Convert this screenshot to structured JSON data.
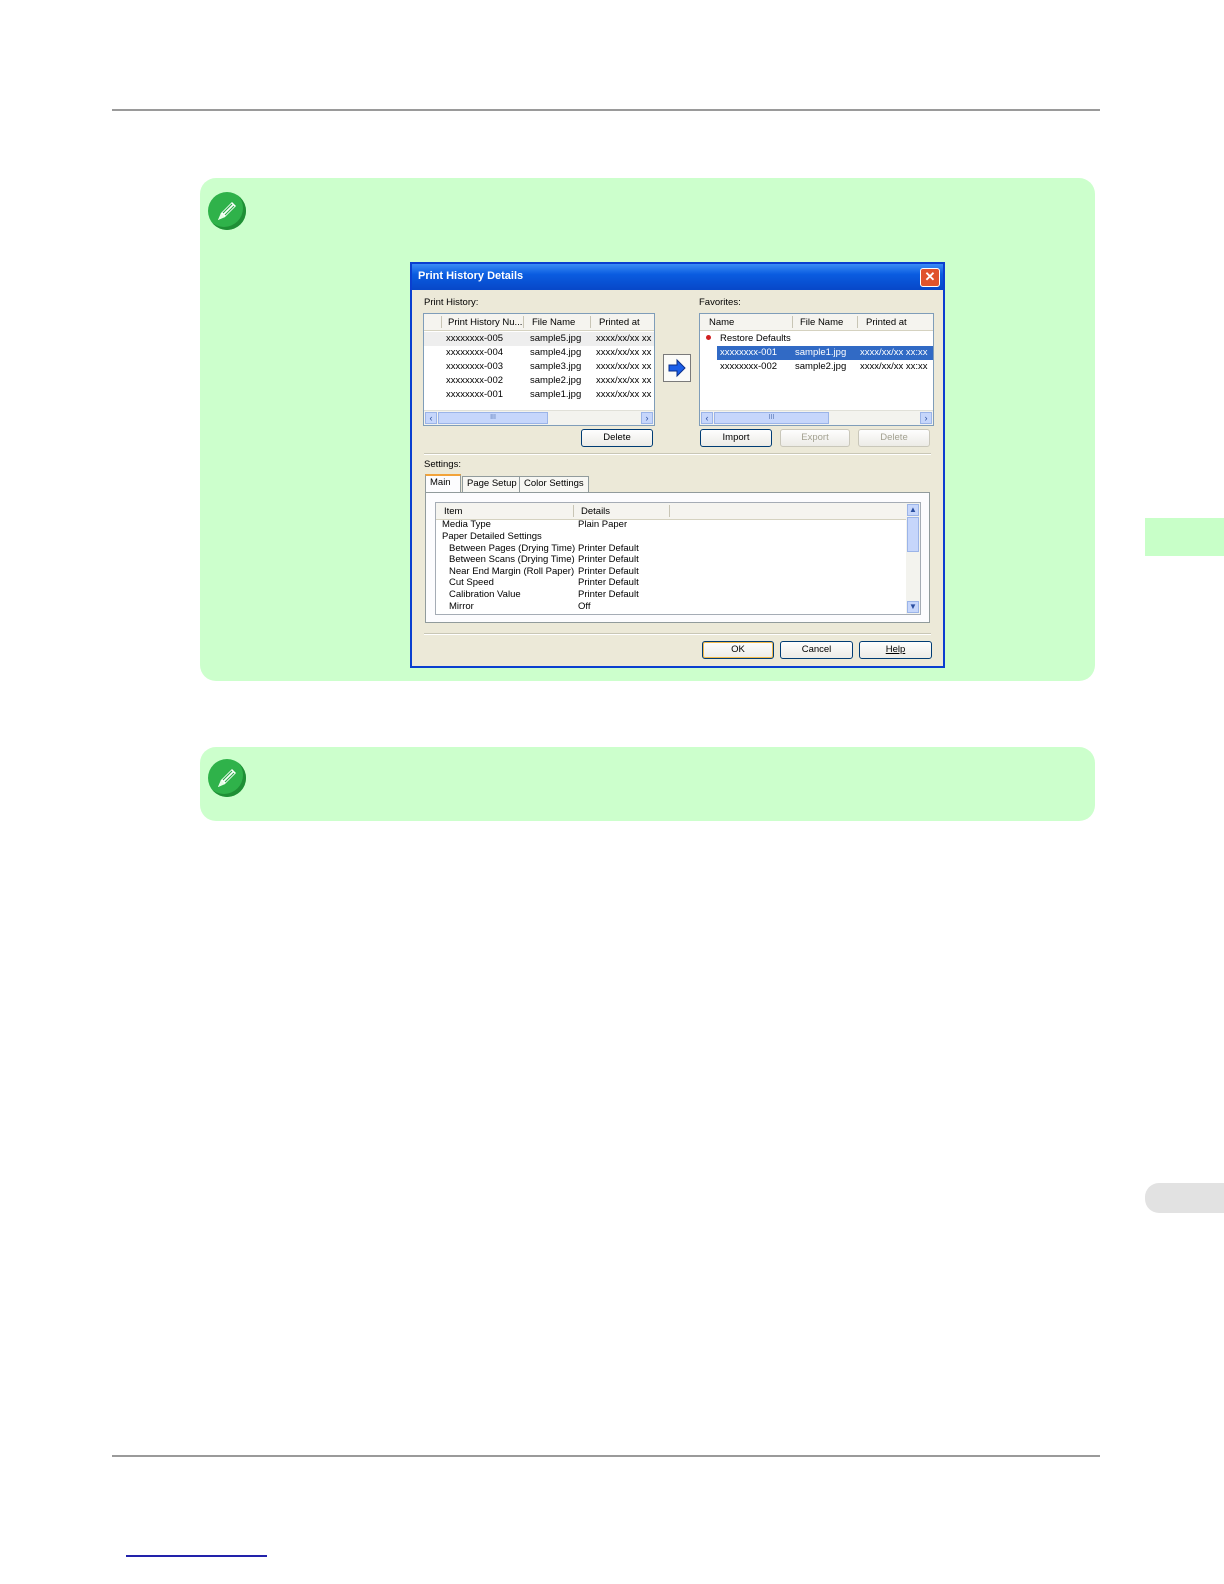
{
  "dialog": {
    "title": "Print History Details",
    "print_history_label": "Print History:",
    "print_history_columns": [
      "Print History Nu...",
      "File Name",
      "Printed at"
    ],
    "print_history_rows": [
      {
        "num": "xxxxxxxx-005",
        "file": "sample5.jpg",
        "printed": "xxxx/xx/xx xx"
      },
      {
        "num": "xxxxxxxx-004",
        "file": "sample4.jpg",
        "printed": "xxxx/xx/xx xx"
      },
      {
        "num": "xxxxxxxx-003",
        "file": "sample3.jpg",
        "printed": "xxxx/xx/xx xx"
      },
      {
        "num": "xxxxxxxx-002",
        "file": "sample2.jpg",
        "printed": "xxxx/xx/xx xx"
      },
      {
        "num": "xxxxxxxx-001",
        "file": "sample1.jpg",
        "printed": "xxxx/xx/xx xx"
      }
    ],
    "delete_label": "Delete",
    "favorites_label": "Favorites:",
    "favorites_columns": [
      "Name",
      "File Name",
      "Printed at"
    ],
    "favorites_rows": [
      {
        "name": "Restore Defaults",
        "file": "",
        "printed": ""
      },
      {
        "name": "xxxxxxxx-001",
        "file": "sample1.jpg",
        "printed": "xxxx/xx/xx xx:xx"
      },
      {
        "name": "xxxxxxxx-002",
        "file": "sample2.jpg",
        "printed": "xxxx/xx/xx xx:xx"
      }
    ],
    "import_label": "Import",
    "export_label": "Export",
    "delete_fav_label": "Delete",
    "settings_label": "Settings:",
    "tabs": [
      "Main",
      "Page Setup",
      "Color Settings"
    ],
    "settings_columns": [
      "Item",
      "Details"
    ],
    "settings_rows": [
      {
        "item": "Media Type",
        "detail": "Plain Paper"
      },
      {
        "item": "Paper Detailed Settings",
        "detail": ""
      },
      {
        "item": "Between Pages (Drying Time)",
        "detail": "Printer Default"
      },
      {
        "item": "Between Scans (Drying Time)",
        "detail": "Printer Default"
      },
      {
        "item": "Near End Margin (Roll Paper)",
        "detail": "Printer Default"
      },
      {
        "item": "Cut Speed",
        "detail": "Printer Default"
      },
      {
        "item": "Calibration Value",
        "detail": "Printer Default"
      },
      {
        "item": "Mirror",
        "detail": "Off"
      }
    ],
    "ok_label": "OK",
    "cancel_label": "Cancel",
    "help_label": "Help",
    "close_glyph": "✕"
  },
  "icons": {
    "note": "pencil-icon",
    "add_to_favorites": "right-arrow-icon"
  },
  "colors": {
    "note_bg": "#ccffcc",
    "title_bar": "#0a5ce0",
    "selection": "#316ac5",
    "side_tab_green": "#c8ffc8",
    "side_tab_grey": "#e2e2e2"
  }
}
